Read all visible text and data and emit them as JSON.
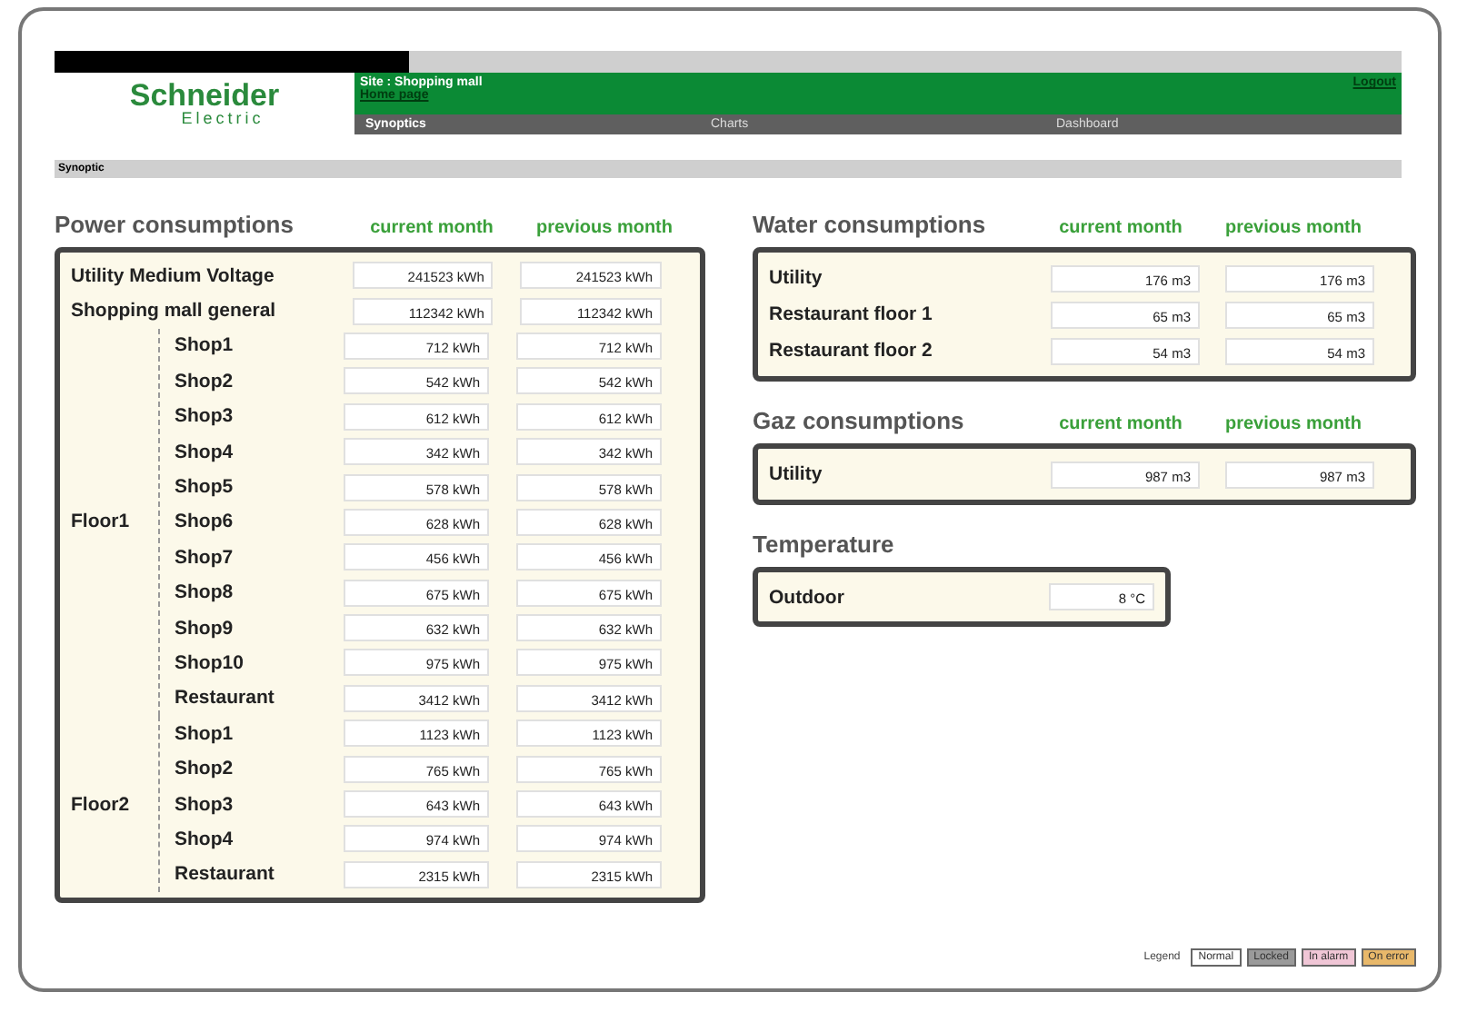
{
  "header": {
    "site": "Site :  Shopping mall",
    "home_link": "Home page",
    "logout": "Logout",
    "logo": {
      "name": "Schneider",
      "sub": "Electric"
    },
    "nav": [
      {
        "label": "Synoptics",
        "selected": true
      },
      {
        "label": "Charts",
        "selected": false
      },
      {
        "label": "Dashboard",
        "selected": false
      }
    ]
  },
  "breadcrumb": "Synoptic",
  "power": {
    "title": "Power consumptions",
    "columns": [
      "current month",
      "previous month"
    ],
    "rows": [
      {
        "label": "Utility Medium Voltage",
        "current": "241523 kWh",
        "previous": "241523 kWh"
      },
      {
        "label": "Shopping mall general",
        "current": "112342 kWh",
        "previous": "112342 kWh"
      }
    ],
    "groups": [
      {
        "label": "Floor1",
        "items": [
          {
            "label": "Shop1",
            "current": "712 kWh",
            "previous": "712 kWh"
          },
          {
            "label": "Shop2",
            "current": "542 kWh",
            "previous": "542 kWh"
          },
          {
            "label": "Shop3",
            "current": "612 kWh",
            "previous": "612 kWh"
          },
          {
            "label": "Shop4",
            "current": "342 kWh",
            "previous": "342 kWh"
          },
          {
            "label": "Shop5",
            "current": "578 kWh",
            "previous": "578 kWh"
          },
          {
            "label": "Shop6",
            "current": "628 kWh",
            "previous": "628 kWh"
          },
          {
            "label": "Shop7",
            "current": "456 kWh",
            "previous": "456 kWh"
          },
          {
            "label": "Shop8",
            "current": "675 kWh",
            "previous": "675 kWh"
          },
          {
            "label": "Shop9",
            "current": "632 kWh",
            "previous": "632 kWh"
          },
          {
            "label": "Shop10",
            "current": "975 kWh",
            "previous": "975 kWh"
          },
          {
            "label": "Restaurant",
            "current": "3412 kWh",
            "previous": "3412 kWh"
          }
        ]
      },
      {
        "label": "Floor2",
        "items": [
          {
            "label": "Shop1",
            "current": "1123 kWh",
            "previous": "1123 kWh"
          },
          {
            "label": "Shop2",
            "current": "765 kWh",
            "previous": "765 kWh"
          },
          {
            "label": "Shop3",
            "current": "643 kWh",
            "previous": "643 kWh"
          },
          {
            "label": "Shop4",
            "current": "974 kWh",
            "previous": "974 kWh"
          },
          {
            "label": "Restaurant",
            "current": "2315 kWh",
            "previous": "2315 kWh"
          }
        ]
      }
    ]
  },
  "water": {
    "title": "Water consumptions",
    "columns": [
      "current month",
      "previous month"
    ],
    "rows": [
      {
        "label": "Utility",
        "current": "176 m3",
        "previous": "176 m3"
      },
      {
        "label": "Restaurant floor 1",
        "current": "65 m3",
        "previous": "65 m3"
      },
      {
        "label": "Restaurant floor 2",
        "current": "54 m3",
        "previous": "54 m3"
      }
    ]
  },
  "gaz": {
    "title": "Gaz consumptions",
    "columns": [
      "current month",
      "previous month"
    ],
    "rows": [
      {
        "label": "Utility",
        "current": "987 m3",
        "previous": "987 m3"
      }
    ]
  },
  "temperature": {
    "title": "Temperature",
    "rows": [
      {
        "label": "Outdoor",
        "value": "8 °C"
      }
    ]
  },
  "legend": {
    "label": "Legend",
    "items": [
      {
        "label": "Normal",
        "color": "#ffffff"
      },
      {
        "label": "Locked",
        "color": "#9a9a9a"
      },
      {
        "label": "In alarm",
        "color": "#f0c6d6"
      },
      {
        "label": "On error",
        "color": "#e8b86a"
      }
    ]
  }
}
